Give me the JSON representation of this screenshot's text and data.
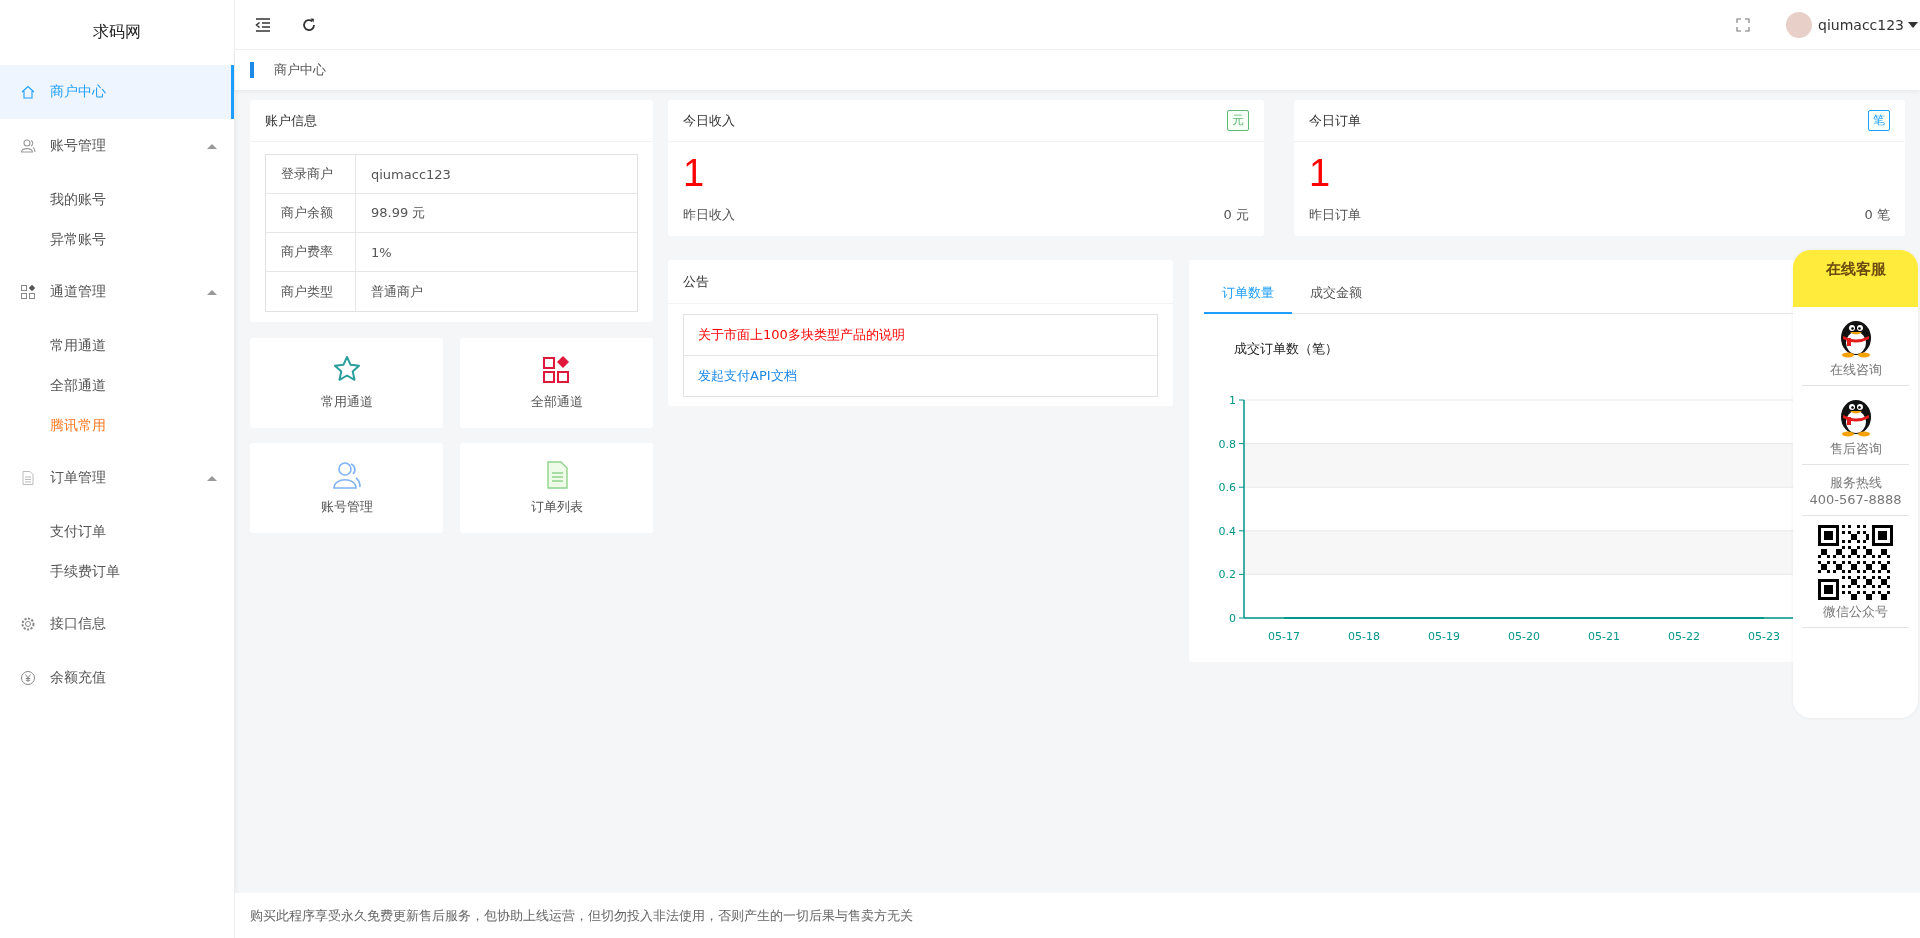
{
  "sidebar": {
    "logo": "求码网",
    "items": [
      {
        "label": "商户中心",
        "selected": true
      },
      {
        "label": "账号管理",
        "selected": false,
        "expanded": true,
        "children": [
          {
            "label": "我的账号",
            "highlighted": false
          },
          {
            "label": "异常账号",
            "highlighted": false
          }
        ]
      },
      {
        "label": "通道管理",
        "selected": false,
        "expanded": true,
        "children": [
          {
            "label": "常用通道",
            "highlighted": false
          },
          {
            "label": "全部通道",
            "highlighted": false
          },
          {
            "label": "腾讯常用",
            "highlighted": true
          }
        ]
      },
      {
        "label": "订单管理",
        "selected": false,
        "expanded": true,
        "children": [
          {
            "label": "支付订单",
            "highlighted": false
          },
          {
            "label": "手续费订单",
            "highlighted": false
          }
        ]
      },
      {
        "label": "接口信息",
        "selected": false
      },
      {
        "label": "余额充值",
        "selected": false
      }
    ]
  },
  "topbar": {
    "username": "qiumacc123"
  },
  "breadcrumb": "商户中心",
  "account": {
    "title": "账户信息",
    "rows": [
      {
        "label": "登录商户",
        "value": "qiumacc123"
      },
      {
        "label": "商户余额",
        "value": "98.99 元"
      },
      {
        "label": "商户费率",
        "value": "1%"
      },
      {
        "label": "商户类型",
        "value": "普通商户"
      }
    ]
  },
  "shortcuts": [
    {
      "label": "常用通道"
    },
    {
      "label": "全部通道"
    },
    {
      "label": "账号管理"
    },
    {
      "label": "订单列表"
    }
  ],
  "stats": [
    {
      "title": "今日收入",
      "badge": "元",
      "color": "#5fb878",
      "value": "1",
      "sub_label": "昨日收入",
      "sub_value": "0 元"
    },
    {
      "title": "今日订单",
      "badge": "笔",
      "color": "#1e9fff",
      "value": "1",
      "sub_label": "昨日订单",
      "sub_value": "0 笔"
    }
  ],
  "notice": {
    "title": "公告",
    "items": [
      {
        "kind": "alert",
        "text": "关于市面上100多块类型产品的说明"
      },
      {
        "kind": "link",
        "text": "发起支付API文档"
      }
    ]
  },
  "chart_card": {
    "tabs": [
      {
        "label": "订单数量",
        "selected": true
      },
      {
        "label": "成交金额",
        "selected": false
      }
    ],
    "chart_data": {
      "type": "line",
      "title": "成交订单数（笔）",
      "categories": [
        "05-17",
        "05-18",
        "05-19",
        "05-20",
        "05-21",
        "05-22",
        "05-23"
      ],
      "series": [
        {
          "color": "#009688",
          "values": [
            0,
            0,
            0,
            0,
            0,
            0,
            0
          ]
        }
      ],
      "grid": true,
      "ylim": [
        0,
        1
      ],
      "yticks": [
        0,
        0.2,
        0.4,
        0.6,
        0.8,
        1
      ]
    }
  },
  "service": {
    "title": "在线客服",
    "items": [
      {
        "kind": "qq",
        "label": "在线咨询"
      },
      {
        "kind": "qq",
        "label": "售后咨询"
      },
      {
        "kind": "hotline",
        "label": "服务热线",
        "number": "400-567-8888"
      },
      {
        "kind": "qr",
        "label": "微信公众号"
      }
    ]
  },
  "footer": "购买此程序享受永久免费更新售后服务，包协助上线运营，但切勿投入非法使用，否则产生的一切后果与售卖方无关"
}
